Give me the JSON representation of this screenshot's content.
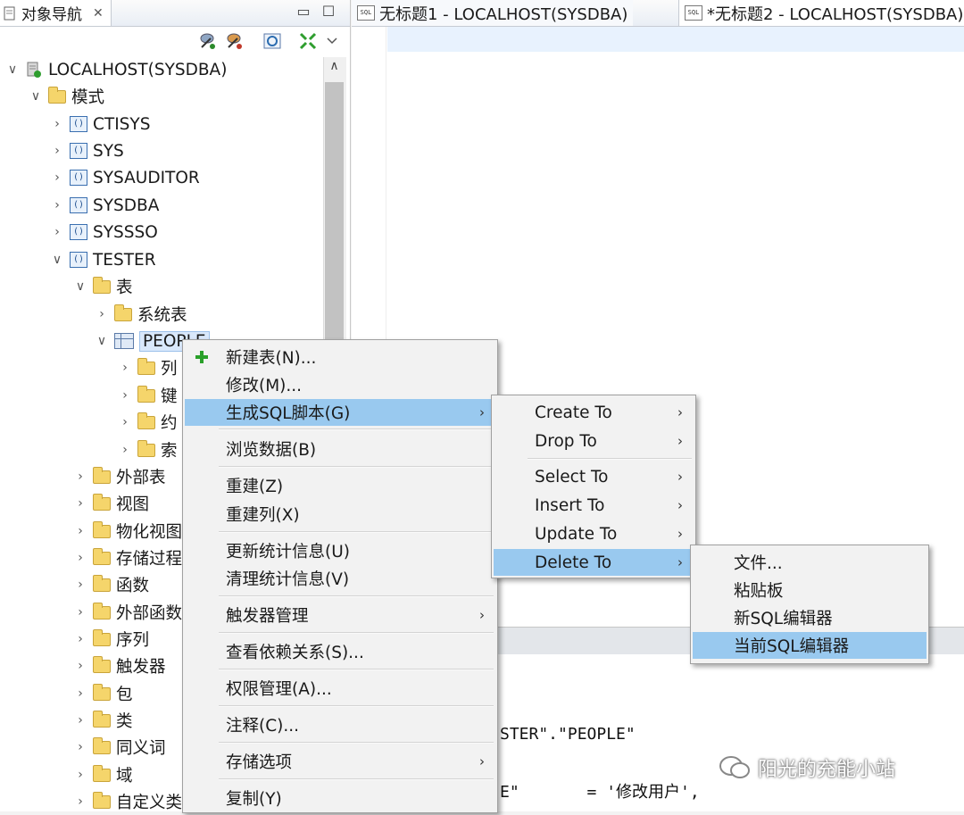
{
  "navigator": {
    "title": "对象导航",
    "close": "✕",
    "minimize": "▭",
    "maximize": "☐"
  },
  "tree": {
    "root": "LOCALHOST(SYSDBA)",
    "schemas_folder": "模式",
    "schemas": [
      "CTISYS",
      "SYS",
      "SYSAUDITOR",
      "SYSDBA",
      "SYSSSO",
      "TESTER"
    ],
    "tables_folder": "表",
    "system_tables": "系统表",
    "selected_table": "PEOPLE",
    "table_children": [
      "列",
      "键",
      "约",
      "索"
    ],
    "other_folders": [
      "外部表",
      "视图",
      "物化视图",
      "存储过程",
      "函数",
      "外部函数",
      "序列",
      "触发器",
      "包",
      "类",
      "同义词",
      "域",
      "自定义类"
    ]
  },
  "editor_tabs": [
    {
      "icon": "SQL",
      "label": "无标题1 - LOCALHOST(SYSDBA)"
    },
    {
      "icon": "SQL",
      "label": "*无标题2 - LOCALHOST(SYSDBA)"
    }
  ],
  "code_lines": [
    "STER\".\"PEOPLE\"",
    "E\"       = '修改用户',"
  ],
  "context_menu": {
    "items": [
      {
        "label": "新建表(N)...",
        "icon": "plus-icon"
      },
      {
        "label": "修改(M)..."
      },
      {
        "label": "生成SQL脚本(G)",
        "submenu": true,
        "highlighted": true
      },
      {
        "label": "浏览数据(B)"
      },
      {
        "label": "重建(Z)"
      },
      {
        "label": "重建列(X)"
      },
      {
        "label": "更新统计信息(U)"
      },
      {
        "label": "清理统计信息(V)"
      },
      {
        "label": "触发器管理",
        "submenu": true
      },
      {
        "label": "查看依赖关系(S)..."
      },
      {
        "label": "权限管理(A)..."
      },
      {
        "label": "注释(C)..."
      },
      {
        "label": "存储选项",
        "submenu": true
      },
      {
        "label": "复制(Y)"
      }
    ]
  },
  "sql_submenu": {
    "items": [
      "Create To",
      "Drop To",
      "Select To",
      "Insert To",
      "Update To",
      "Delete To"
    ],
    "highlighted": "Delete To"
  },
  "delete_submenu": {
    "items": [
      "文件...",
      "粘贴板",
      "新SQL编辑器",
      "当前SQL编辑器"
    ],
    "highlighted": "当前SQL编辑器"
  },
  "watermark": "阳光的充能小站",
  "colors": {
    "menu_highlight": "#99c9ef",
    "folder": "#f5d56b",
    "selection": "#d9e8fb"
  }
}
